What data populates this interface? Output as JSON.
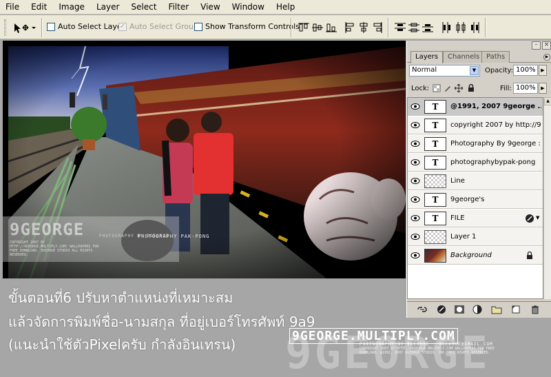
{
  "menu": [
    "File",
    "Edit",
    "Image",
    "Layer",
    "Select",
    "Filter",
    "View",
    "Window",
    "Help"
  ],
  "options": {
    "move_tool_icon": "move-tool-icon",
    "auto_select_layer": "Auto Select Layer",
    "auto_select_groups": "Auto Select Groups",
    "show_transform_controls": "Show Transform Controls"
  },
  "canvas": {
    "watermark_big": "9GEORGE",
    "watermark_small": "PHOTOGRAPHY  PAK-PONG",
    "watermark_credit": "PHOTOGRAPHY BY 9GEORGE",
    "watermark_tiny": "COPYRIGHT 2007 BY HTTP://9GEORGE.MULTIPLY.COM/ WALLPAPERS FOR FREE DOWNLOAD. 9GEORGE STUDIO ALL RIGHTS RESERVED."
  },
  "layers_panel": {
    "tabs": [
      "Layers",
      "Channels",
      "Paths"
    ],
    "blend_mode": "Normal",
    "opacity_label": "Opacity:",
    "opacity_value": "100%",
    "lock_label": "Lock:",
    "fill_label": "Fill:",
    "fill_value": "100%",
    "layers": [
      {
        "name": "@1991, 2007 9george ...",
        "kind": "text",
        "selected": true
      },
      {
        "name": "copyright 2007 by  http://9...",
        "kind": "text"
      },
      {
        "name": "Photography By 9george : ...",
        "kind": "text"
      },
      {
        "name": "photographybypak-pong",
        "kind": "text"
      },
      {
        "name": "Line",
        "kind": "pixel"
      },
      {
        "name": "9george's",
        "kind": "text"
      },
      {
        "name": "FILE",
        "kind": "text",
        "fx": true
      },
      {
        "name": "Layer 1",
        "kind": "pixel"
      },
      {
        "name": "Background",
        "kind": "photo",
        "locked": true
      }
    ]
  },
  "caption": {
    "line1": "ขั้นตอนที่6  ปรับหาตำแหน่งที่เหมาะสม",
    "line2": "แล้วจัดการพิมพ์ชื่อ-นามสกุล  ที่อยู่เบอร์โทรศัพท์  9a9",
    "line3": "(แนะนำใช้ตัวPixelครับ  กำลังอินเทรน)",
    "site_url": "9GEORGE.MULTIPLY.COM",
    "site_ghost": "9GEORGE",
    "site_sub": "PHOTOGRAPHY BY 9GEORGE : 9GEORGE@GMAIL.COM",
    "site_fine": "COPYRIGHT 2007 BY HTTP://9GEORGE.MULTIPLY.COM WALLPAPERS FOR FREE DOWNLOAD. @1991, 2007 9GEORGE STUDIO, INC. ALL RIGHTS RESERVED."
  }
}
